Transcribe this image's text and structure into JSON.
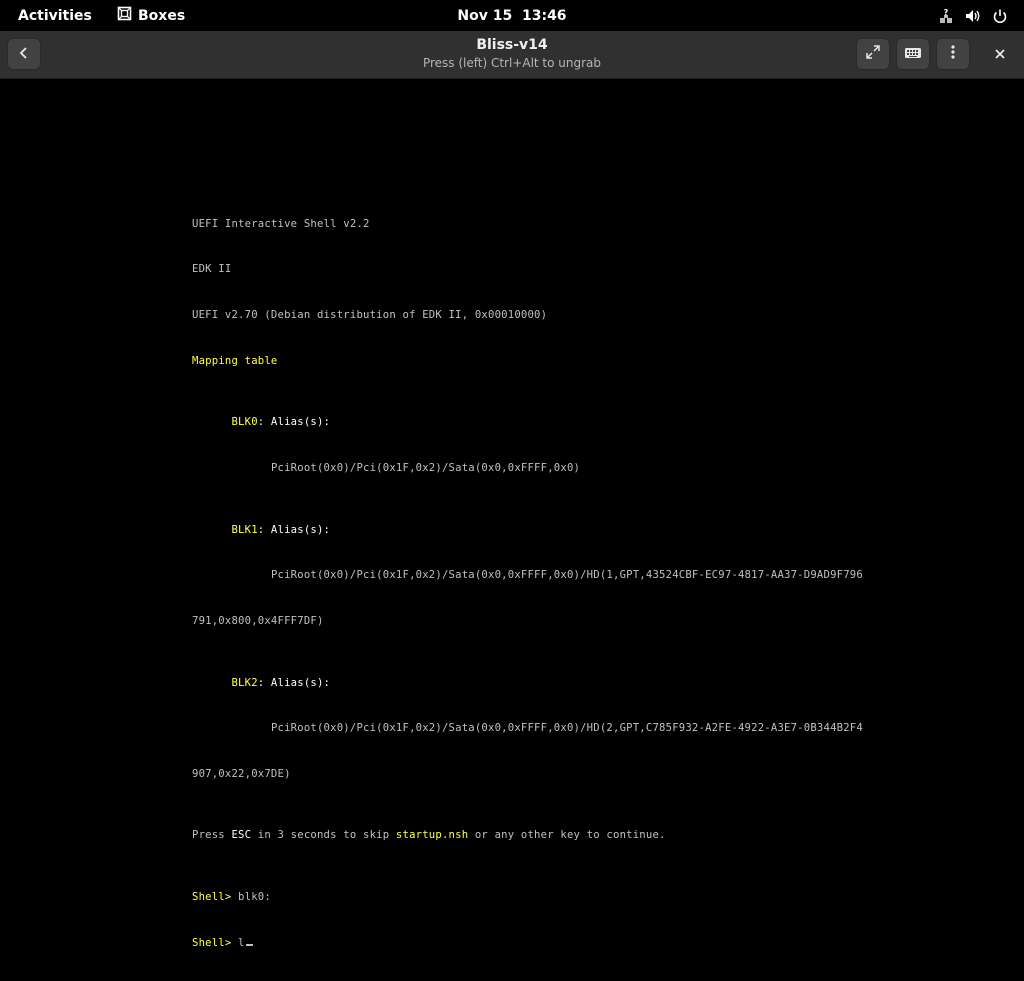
{
  "topbar": {
    "activities": "Activities",
    "app_name": "Boxes",
    "clock": "Nov 15  13:46",
    "icons": [
      "network-unknown-icon",
      "volume-icon",
      "power-icon"
    ]
  },
  "headerbar": {
    "title": "Bliss-v14",
    "subtitle": "Press (left) Ctrl+Alt to ungrab",
    "icons": [
      "back-icon",
      "fullscreen-icon",
      "keyboard-icon",
      "menu-dots-icon",
      "close-icon"
    ]
  },
  "console": {
    "line1": "UEFI Interactive Shell v2.2",
    "line2": "EDK II",
    "line3": "UEFI v2.70 (Debian distribution of EDK II, 0x00010000)",
    "line4": "Mapping table",
    "blk0_label": "BLK0",
    "blk1_label": "BLK1",
    "blk2_label": "BLK2",
    "alias": ": Alias(s):",
    "blk0_path": "PciRoot(0x0)/Pci(0x1F,0x2)/Sata(0x0,0xFFFF,0x0)",
    "blk1_path_a": "PciRoot(0x0)/Pci(0x1F,0x2)/Sata(0x0,0xFFFF,0x0)/HD(1,GPT,43524CBF-EC97-4817-AA37-D9AD9F796",
    "blk1_path_b": "791,0x800,0x4FFF7DF)",
    "blk2_path_a": "PciRoot(0x0)/Pci(0x1F,0x2)/Sata(0x0,0xFFFF,0x0)/HD(2,GPT,C785F932-A2FE-4922-A3E7-0B344B2F4",
    "blk2_path_b": "907,0x22,0x7DE)",
    "press_1": "Press ",
    "press_esc": "ESC",
    "press_2": " in 3 seconds to skip ",
    "press_startup": "startup.nsh",
    "press_3": " or any other key to continue.",
    "prompt": "Shell>",
    "cmd1": " blk0:",
    "cmd2": " l"
  },
  "colors": {
    "topbar_bg": "#000000",
    "headerbar_bg": "#303030",
    "console_text": "#c0c0c0",
    "console_yellow": "#ffff54",
    "console_white": "#ffffff"
  }
}
